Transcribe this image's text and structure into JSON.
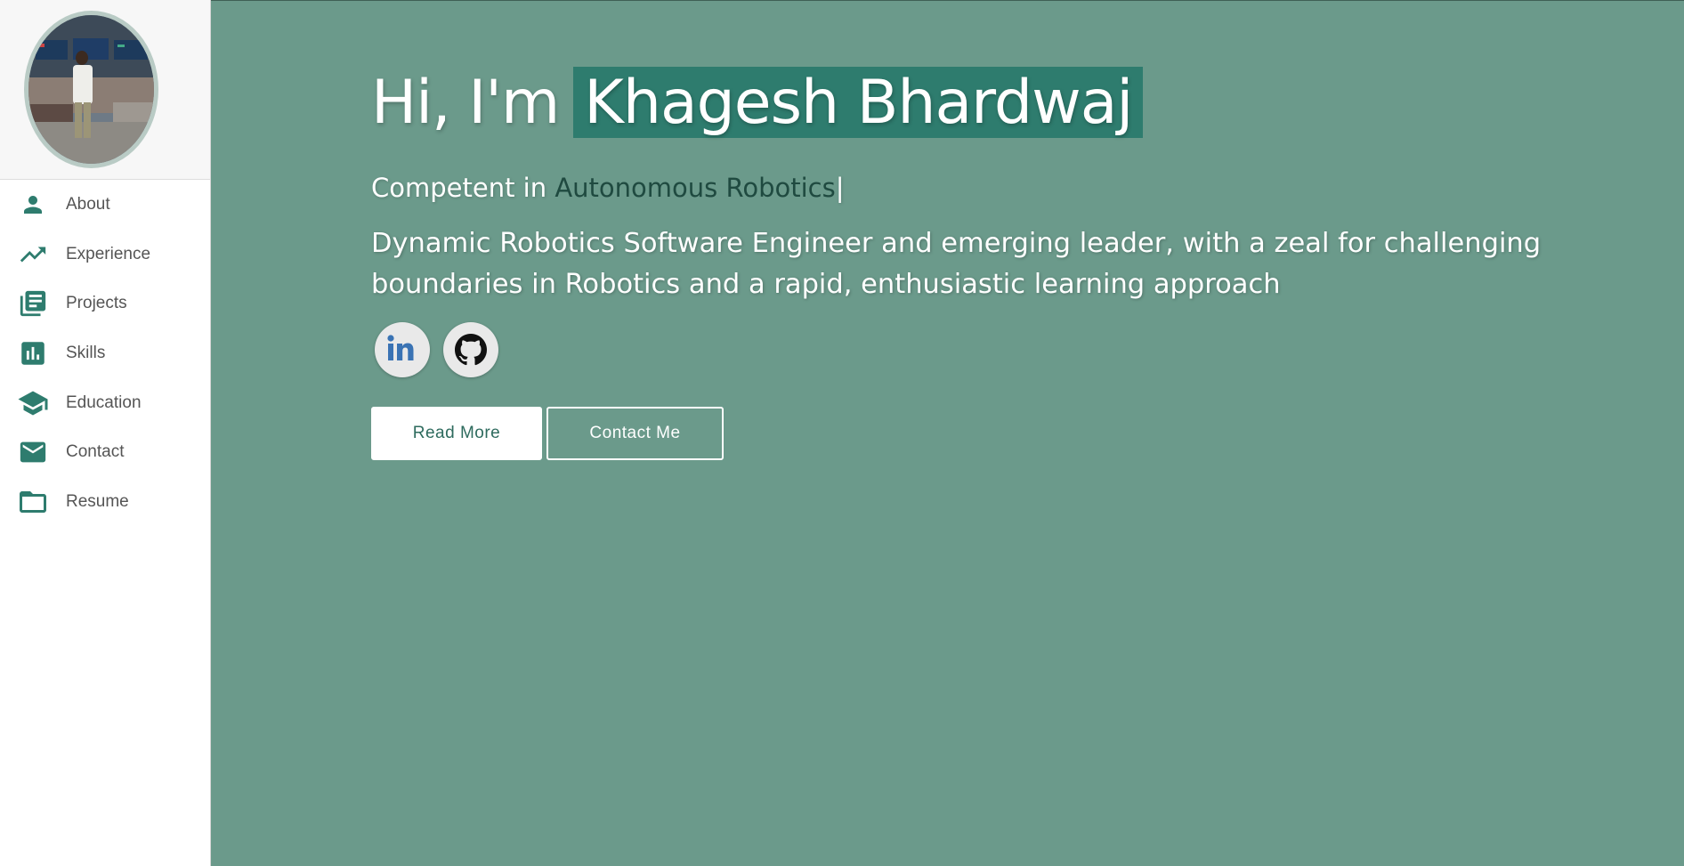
{
  "colors": {
    "accent": "#2e7c6e",
    "main_background": "#6b9a8b",
    "sidebar_background": "#ffffff",
    "icon_color": "#2e7c6e",
    "typed_text": "#1f4a40"
  },
  "sidebar": {
    "items": [
      {
        "label": "About",
        "icon": "person-icon"
      },
      {
        "label": "Experience",
        "icon": "trending-up-icon"
      },
      {
        "label": "Projects",
        "icon": "library-books-icon"
      },
      {
        "label": "Skills",
        "icon": "bar-chart-icon"
      },
      {
        "label": "Education",
        "icon": "graduation-cap-icon"
      },
      {
        "label": "Contact",
        "icon": "mail-icon"
      },
      {
        "label": "Resume",
        "icon": "folder-icon"
      }
    ]
  },
  "hero": {
    "greeting": "Hi, I'm",
    "name": "Khagesh Bhardwaj",
    "competent_prefix": "Competent in",
    "competent_typed": "Autonomous Robotics",
    "cursor": "|",
    "description": "Dynamic Robotics Software Engineer and emerging leader, with a zeal for challenging boundaries in Robotics and a rapid, enthusiastic learning approach",
    "socials": [
      {
        "name": "LinkedIn",
        "icon": "linkedin-icon"
      },
      {
        "name": "GitHub",
        "icon": "github-icon"
      }
    ],
    "read_more_label": "Read More",
    "contact_me_label": "Contact Me"
  }
}
